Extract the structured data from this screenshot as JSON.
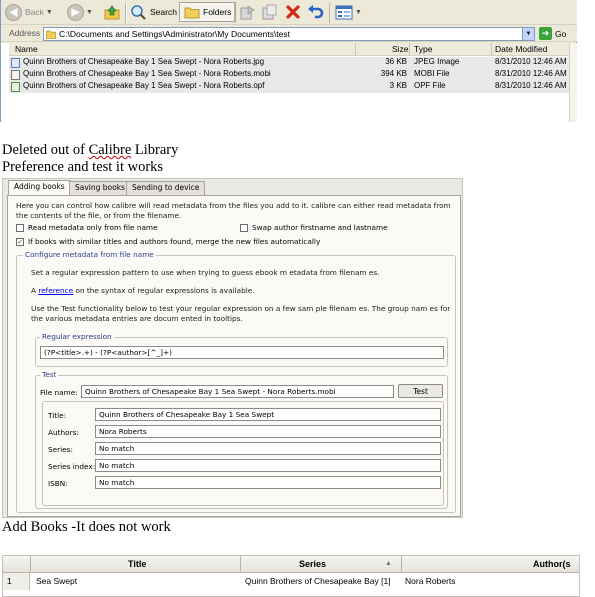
{
  "toolbar": {
    "back_label": "Back",
    "search_label": "Search",
    "folders_label": "Folders"
  },
  "address": {
    "label": "Address",
    "path": "C:\\Documents and Settings\\Administrator\\My Documents\\test",
    "go_label": "Go"
  },
  "files": {
    "columns": [
      "Name",
      "Size",
      "Type",
      "Date Modified"
    ],
    "rows": [
      {
        "name": "Quinn Brothers of Chesapeake Bay 1 Sea Swept - Nora Roberts.jpg",
        "size": "36 KB",
        "type": "JPEG Image",
        "date": "8/31/2010 12:46 AM"
      },
      {
        "name": "Quinn Brothers of Chesapeake Bay 1 Sea Swept - Nora Roberts.mobi",
        "size": "394 KB",
        "type": "MOBI File",
        "date": "8/31/2010 12:46 AM"
      },
      {
        "name": "Quinn Brothers of Chesapeake Bay 1 Sea Swept - Nora Roberts.opf",
        "size": "3 KB",
        "type": "OPF File",
        "date": "8/31/2010 12:46 AM"
      }
    ]
  },
  "captions": {
    "line1_a": "Deleted out of ",
    "line1_b": "Calibre",
    "line1_c": " Library",
    "line2": "Preference and test it works",
    "line3": "Add Books -It does not work"
  },
  "prefs": {
    "tabs": [
      "Adding books",
      "Saving books",
      "Sending to device"
    ],
    "intro": "Here you can control how calibre will read metadata from the files you add to it. calibre can either read metadata from the contents of the file, or from the filename.",
    "cb_read_filename": "Read metadata only from file name",
    "cb_swap_author": "Swap author firstname and lastname",
    "cb_merge": "If books with similar titles and authors found, merge the new files automatically",
    "configure_title": "Configure metadata from file name",
    "regex_intro": "Set a regular expression pattern to use when trying to guess ebook m etadata from filenam es.",
    "ref_a": "A ",
    "ref_link": "reference",
    "ref_b": " on the syntax of regular expressions is available.",
    "test_intro": "Use the Test functionality below to test your regular expression on a few sam ple filenam es. The group nam es for the various metadata entries are docum ented in tooltips.",
    "regex_group": "Regular expression",
    "regex_value": "(?P<title>.+) - (?P<author>[^_]+)",
    "test_group": "Test",
    "file_name_label": "File name:",
    "file_name_value": "Quinn Brothers of Chesapeake Bay 1 Sea Swept - Nora Roberts.mobi",
    "test_button": "Test",
    "results": [
      {
        "label": "Title:",
        "value": "Quinn Brothers of Chesapeake Bay 1 Sea Swept"
      },
      {
        "label": "Authors:",
        "value": "Nora Roberts"
      },
      {
        "label": "Series:",
        "value": "No match"
      },
      {
        "label": "Series index:",
        "value": "No match"
      },
      {
        "label": "ISBN:",
        "value": "No match"
      }
    ]
  },
  "books": {
    "columns": [
      "Title",
      "Series",
      "Author(s"
    ],
    "rows": [
      {
        "num": "1",
        "title": "Sea Swept",
        "series": "Quinn Brothers of Chesapeake Bay [1]",
        "author": "Nora Roberts"
      }
    ]
  }
}
